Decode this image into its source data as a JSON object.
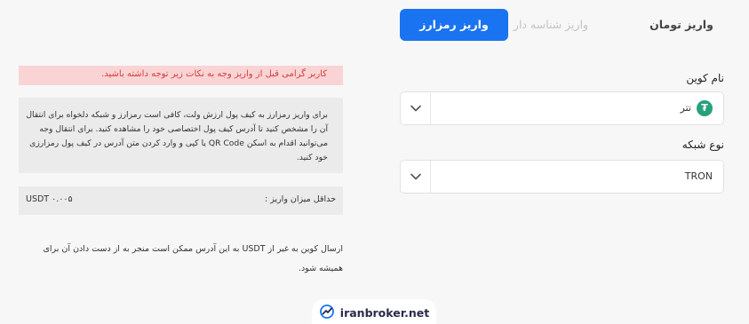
{
  "tabs": {
    "toman": "واریز تومان",
    "id_deposit": "واریز شناسه دار",
    "crypto": "واریز رمزارز"
  },
  "form": {
    "coin_label": "نام کوین",
    "coin_value": "تتر",
    "coin_icon": "tether-icon",
    "network_label": "نوع شبکه",
    "network_value": "TRON"
  },
  "info": {
    "warning": "کاربر گرامی قبل از واریز وجه به نکات زیر توجه داشته باشید.",
    "instructions": "برای واریز رمزارز به کیف پول ارزش ولت، کافی است رمزارز و شبکه دلخواه برای انتقال آن را مشخص کنید تا آدرس کیف پول اختصاصی خود را مشاهده کنید. برای انتقال وجه می‌توانید اقدام به اسکن QR Code یا کپی و وارد کردن متن آدرس در کیف پول رمزارزی خود کنید.",
    "min_label": "حداقل میزان واریز :",
    "min_value": "USDT ۰.۰۰۵",
    "note": "ارسال کوین به غیر از USDT به این آدرس ممکن است منجر به از دست دادن آن برای همیشه شود."
  },
  "brand": {
    "name": "iranbroker.net",
    "color": "#1a73f0"
  },
  "colors": {
    "accent": "#1a73f0",
    "warning_bg": "#fad4d4",
    "warning_text": "#d33c3c",
    "tether": "#26a17b"
  }
}
